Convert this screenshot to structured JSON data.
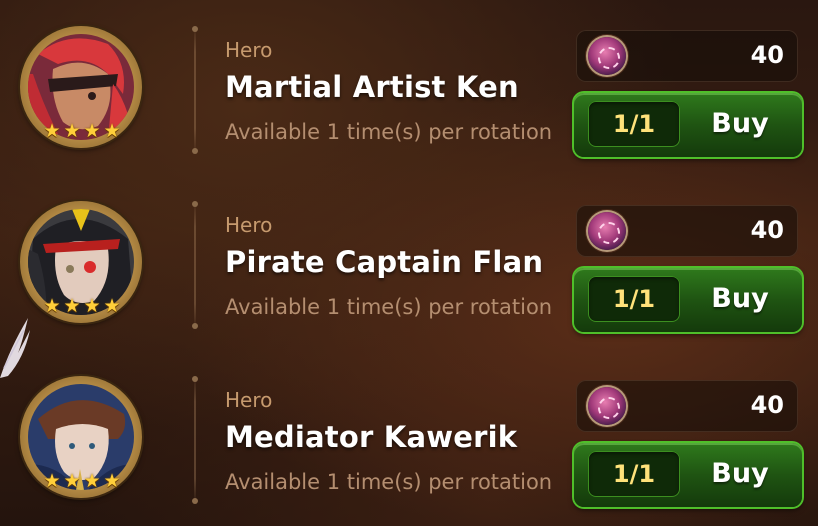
{
  "colors": {
    "accent_green": "#2f7a1c",
    "price_text": "#ffffff",
    "stock_text": "#ffe27a",
    "category_text": "#c69a6e",
    "availability_text": "#b48e70"
  },
  "items": [
    {
      "category": "Hero",
      "name": "Martial Artist Ken",
      "availability": "Available 1 time(s) per rotation",
      "stars": 4,
      "currency_icon": "gem-coin-icon",
      "price": "40",
      "stock": "1/1",
      "buy_label": "Buy"
    },
    {
      "category": "Hero",
      "name": "Pirate Captain Flan",
      "availability": "Available 1 time(s) per rotation",
      "stars": 4,
      "currency_icon": "gem-coin-icon",
      "price": "40",
      "stock": "1/1",
      "buy_label": "Buy"
    },
    {
      "category": "Hero",
      "name": "Mediator Kawerik",
      "availability": "Available 1 time(s) per rotation",
      "stars": 4,
      "currency_icon": "gem-coin-icon",
      "price": "40",
      "stock": "1/1",
      "buy_label": "Buy"
    }
  ]
}
